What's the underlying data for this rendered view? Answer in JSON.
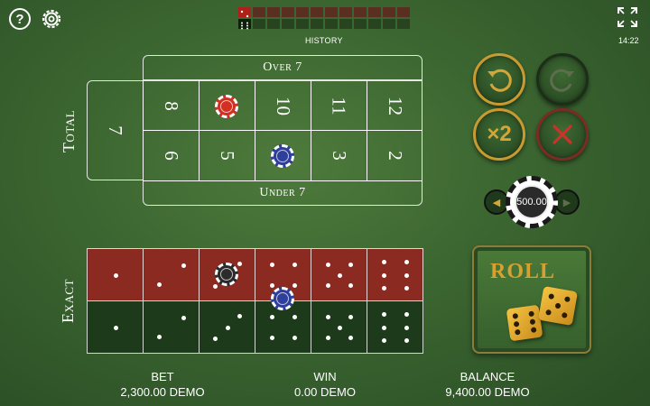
{
  "header": {
    "help_label": "?",
    "clock": "14:22",
    "history_label": "HISTORY"
  },
  "icons": {
    "help": "help-icon",
    "settings": "gear-icon",
    "fullscreen": "fullscreen-icon"
  },
  "totals": {
    "over_label": "Over 7",
    "under_label": "Under 7",
    "total_label": "Total",
    "seven": "7",
    "top_row": [
      "8",
      "9",
      "10",
      "11",
      "12"
    ],
    "bottom_row": [
      "6",
      "5",
      "4",
      "3",
      "2"
    ]
  },
  "exact": {
    "label": "Exact",
    "faces": [
      1,
      2,
      3,
      4,
      5,
      6
    ]
  },
  "controls": {
    "double_label": "×2",
    "chip_value": "500.00",
    "roll_label": "ROLL"
  },
  "footer": {
    "bet_label": "BET",
    "bet_value": "2,300.00 DEMO",
    "win_label": "WIN",
    "win_value": "0.00 DEMO",
    "balance_label": "BALANCE",
    "balance_value": "9,400.00 DEMO"
  },
  "colors": {
    "felt": "#3b6530",
    "exact_red": "#8a2a20",
    "exact_dark": "#1d3a1a",
    "gold": "#d5a232",
    "chip_red": "#d23022",
    "chip_blue": "#2f3f9c"
  }
}
